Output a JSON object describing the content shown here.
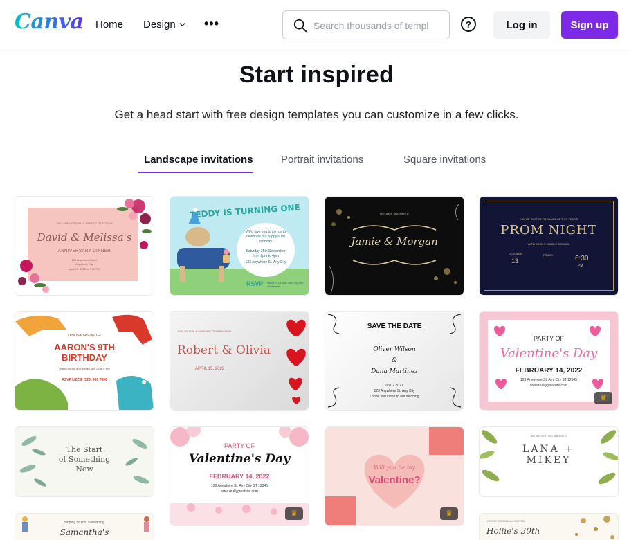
{
  "header": {
    "logo": "Canva",
    "nav": {
      "home": "Home",
      "design": "Design",
      "more": "•••"
    },
    "search": {
      "placeholder": "Search thousands of templ",
      "value": ""
    },
    "help": "?",
    "login": "Log in",
    "signup": "Sign up"
  },
  "hero": {
    "title": "Start inspired",
    "subtitle": "Get a head start with free design templates you can customize in a few clicks."
  },
  "tabs": [
    {
      "label": "Landscape invitations",
      "active": true
    },
    {
      "label": "Portrait invitations",
      "active": false
    },
    {
      "label": "Square invitations",
      "active": false
    }
  ],
  "templates": {
    "t1": {
      "name": "David & Melissa's",
      "line1": "YOU ARE CORDIALLY INVITED TO ATTEND",
      "line2": "ANNIVERSARY DINNER",
      "line3": "123 Anywhere Street",
      "line4": "Anywhere City",
      "line5": "April 29, 2022 at 7:00 PM"
    },
    "t2": {
      "headline": "TEDDY IS TURNING ONE",
      "body": "We'd love you to join us to celebrate our puppy's 1st birthday",
      "date": "Saturday 25th September from 2pm to 4pm",
      "address": "123 Anywhere St. Any City",
      "rsvp": "RSVP",
      "rsvp_detail": "Olivia +123-456-7890 by 25th September"
    },
    "t3": {
      "top": "WE ARE MARRIED",
      "names": "Jamie & Morgan"
    },
    "t4": {
      "top": "YOU'RE INVITED TO DANCE AT THIS YEAR'S",
      "title": "PROM NIGHT",
      "school": "WITH BRIGHT MIDDLE SCHOOL",
      "month": "OCTOBER",
      "day": "13",
      "weekday": "FRIDAY",
      "time": "6:30",
      "pm": "PM"
    },
    "t5": {
      "top": "DINOSAURS UNITE!",
      "title1": "AARON'S 9TH",
      "title2": "BIRTHDAY",
      "body": "Watch for fun and games July 22 at 5 PM",
      "rsvp": "RSVP LIZZIE (123) 456 7890"
    },
    "t6": {
      "top": "JOIN US FOR A WEDDING CELEBRATION",
      "names": "Robert & Olivia",
      "date": "APRIL 15, 2022"
    },
    "t7": {
      "title": "SAVE THE DATE",
      "name1": "Oliver Wilson",
      "amp": "&",
      "name2": "Dana Martinez",
      "date": "05.02.2021",
      "place": "123 Anywhere St, Any City",
      "note": "I hope you come to our wedding"
    },
    "t8": {
      "top": "PARTY OF",
      "title": "Valentine's Day",
      "date": "FEBRUARY 14, 2022",
      "address": "123 Anywhere St, Any City ST 12345",
      "site": "www.reallygreatsite.com"
    },
    "t9": {
      "line1": "The Start",
      "line2": "of Something",
      "line3": "New"
    },
    "t10": {
      "top": "PARTY OF",
      "title": "Valentine's Day",
      "date": "FEBRUARY 14, 2022",
      "address": "123 Anywhere St, Any City ST 12345",
      "site": "www.reallygreatsite.com"
    },
    "t11": {
      "line1": "Will you be my",
      "line2": "Valentine?"
    },
    "t12": {
      "top": "WE'RE GETTING MARRIED",
      "name1": "LANA +",
      "name2": "MIKEY"
    },
    "t13": {
      "top": "Hoping of This Something",
      "name": "Samantha's"
    },
    "t14": {
      "top": "YOU'RE CORDIALLY INVITED",
      "name": "Hollie's 30th"
    }
  },
  "colors": {
    "brand_purple": "#7d2ae8",
    "brand_teal": "#00c4cc"
  }
}
